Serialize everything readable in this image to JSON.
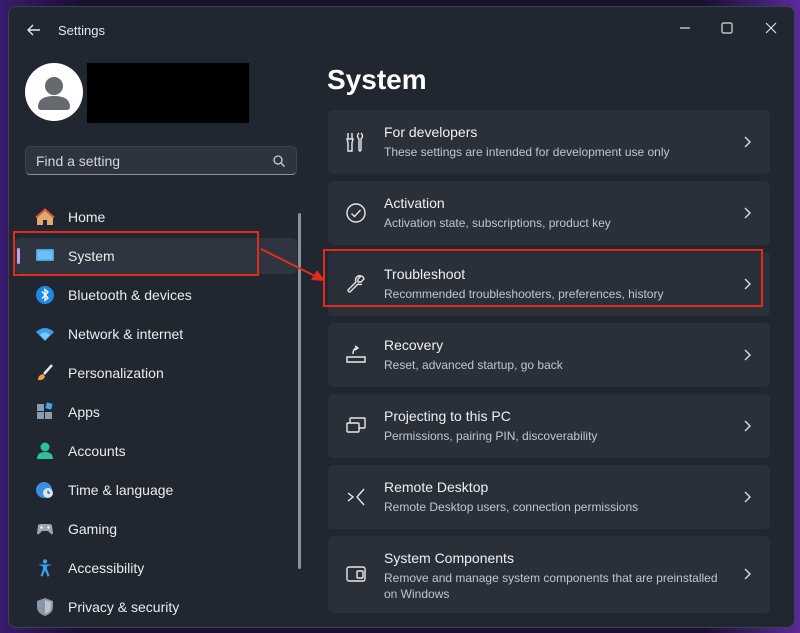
{
  "window": {
    "title": "Settings"
  },
  "search": {
    "placeholder": "Find a setting"
  },
  "sidebar": {
    "items": [
      {
        "label": "Home",
        "icon": "home-icon"
      },
      {
        "label": "System",
        "icon": "system-icon",
        "selected": true
      },
      {
        "label": "Bluetooth & devices",
        "icon": "bluetooth-icon"
      },
      {
        "label": "Network & internet",
        "icon": "wifi-icon"
      },
      {
        "label": "Personalization",
        "icon": "brush-icon"
      },
      {
        "label": "Apps",
        "icon": "apps-icon"
      },
      {
        "label": "Accounts",
        "icon": "accounts-icon"
      },
      {
        "label": "Time & language",
        "icon": "globe-clock-icon"
      },
      {
        "label": "Gaming",
        "icon": "gamepad-icon"
      },
      {
        "label": "Accessibility",
        "icon": "accessibility-icon"
      },
      {
        "label": "Privacy & security",
        "icon": "shield-icon"
      }
    ]
  },
  "main": {
    "title": "System",
    "cards": [
      {
        "title": "For developers",
        "desc": "These settings are intended for development use only",
        "icon": "developer-tools-icon"
      },
      {
        "title": "Activation",
        "desc": "Activation state, subscriptions, product key",
        "icon": "checkmark-circle-icon"
      },
      {
        "title": "Troubleshoot",
        "desc": "Recommended troubleshooters, preferences, history",
        "icon": "wrench-icon"
      },
      {
        "title": "Recovery",
        "desc": "Reset, advanced startup, go back",
        "icon": "recovery-icon"
      },
      {
        "title": "Projecting to this PC",
        "desc": "Permissions, pairing PIN, discoverability",
        "icon": "projecting-icon"
      },
      {
        "title": "Remote Desktop",
        "desc": "Remote Desktop users, connection permissions",
        "icon": "remote-desktop-icon"
      },
      {
        "title": "System Components",
        "desc": "Remove and manage system components that are preinstalled on Windows",
        "icon": "system-components-icon"
      }
    ]
  },
  "colors": {
    "highlight": "#e32a1c",
    "accent": "#c5a0f3",
    "window_bg": "#202731",
    "card_bg": "#2a303a"
  }
}
